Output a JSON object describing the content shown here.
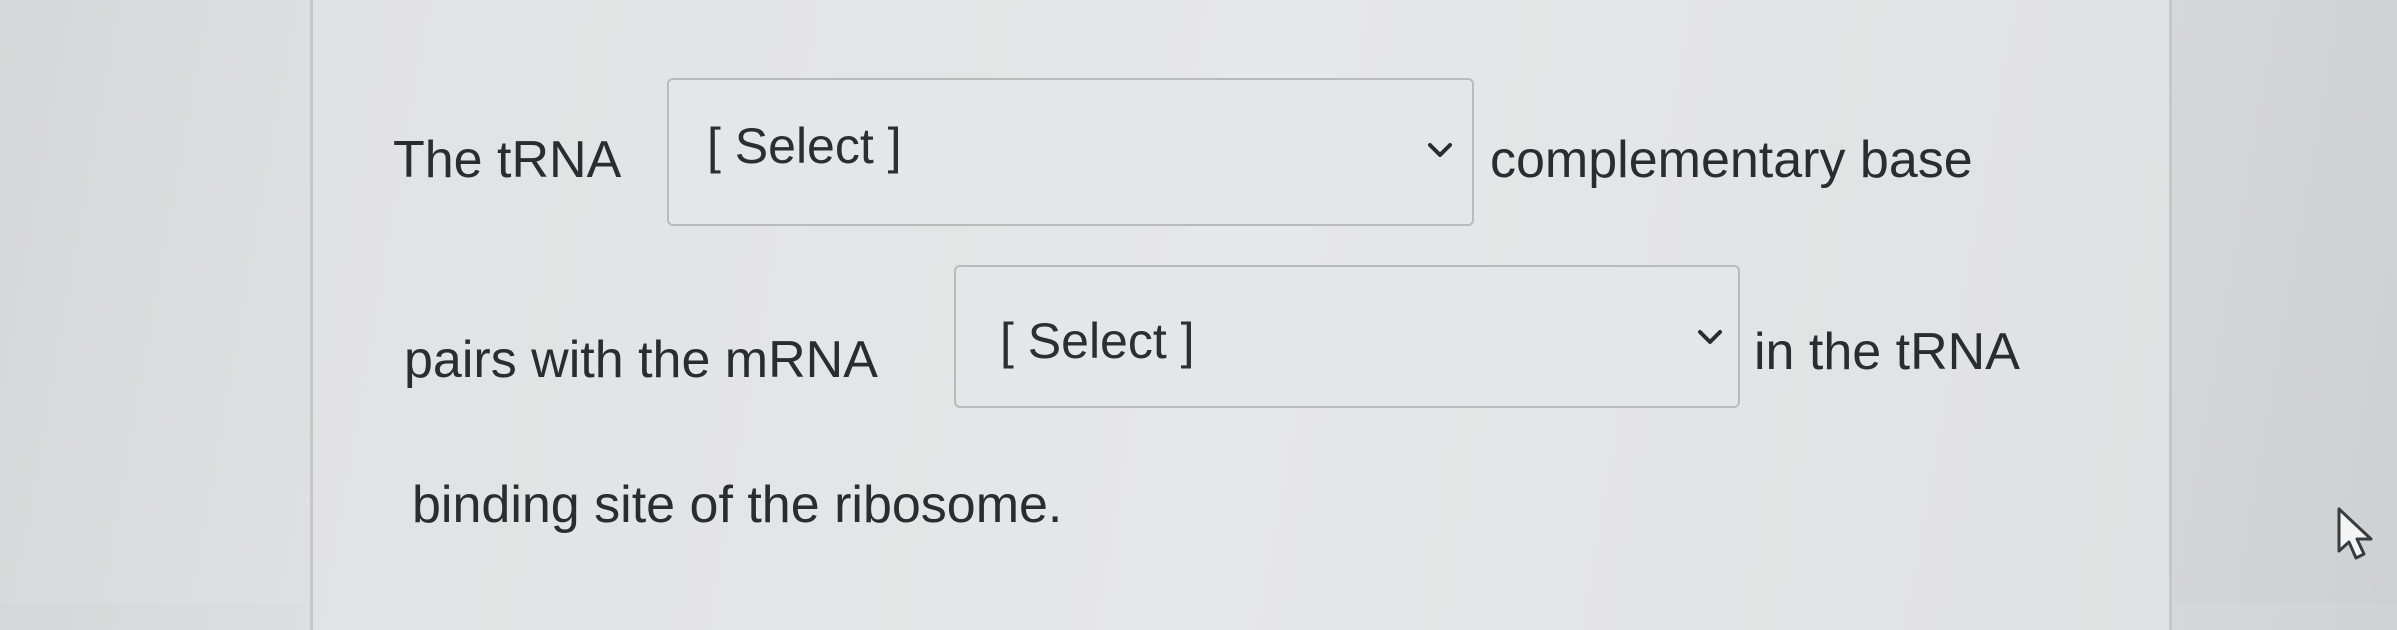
{
  "question": {
    "line1_start": "The tRNA",
    "line1_end": "complementary base",
    "line2_start": "pairs with the mRNA",
    "line2_end": "in the tRNA",
    "line3": "binding site of the ribosome."
  },
  "dropdowns": [
    {
      "selected": "[ Select ]",
      "icon": "chevron-down-icon"
    },
    {
      "selected": "[ Select ]",
      "icon": "chevron-down-icon"
    }
  ],
  "cursor": {
    "icon": "mouse-pointer-icon"
  }
}
